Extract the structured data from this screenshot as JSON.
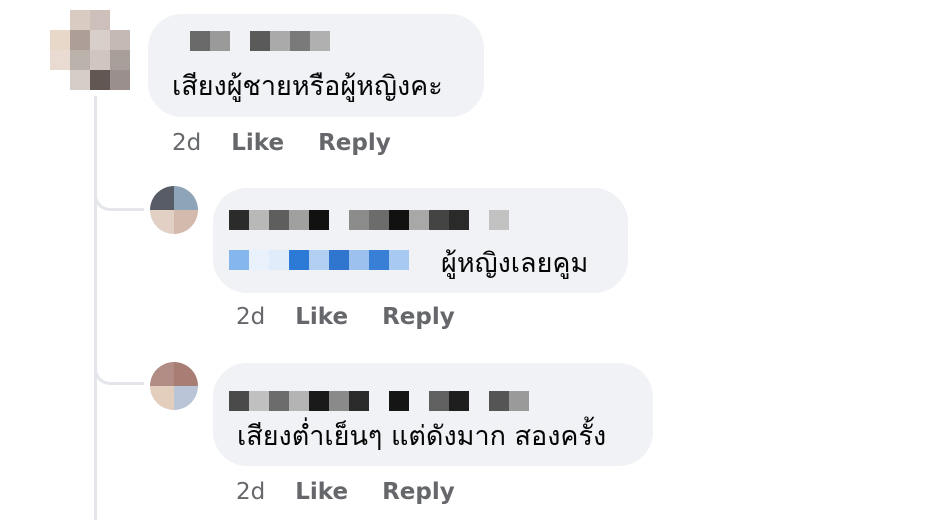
{
  "comments": [
    {
      "text": "เสียงผู้ชายหรือผู้หญิงคะ",
      "time": "2d",
      "like_label": "Like",
      "reply_label": "Reply"
    }
  ],
  "replies": [
    {
      "text": "ผู้หญิงเลยคูม",
      "time": "2d",
      "like_label": "Like",
      "reply_label": "Reply",
      "mention": "tagged name (blurred)"
    },
    {
      "text": "เสียงต่ำเย็นๆ แต่ดังมาก สองครั้ง",
      "time": "2d",
      "like_label": "Like",
      "reply_label": "Reply"
    }
  ],
  "colors": {
    "bubble_bg": "#f0f2f5",
    "meta_text": "#65676b",
    "thread_line": "#e4e6eb",
    "mention_blue": "#2d7ad6"
  }
}
